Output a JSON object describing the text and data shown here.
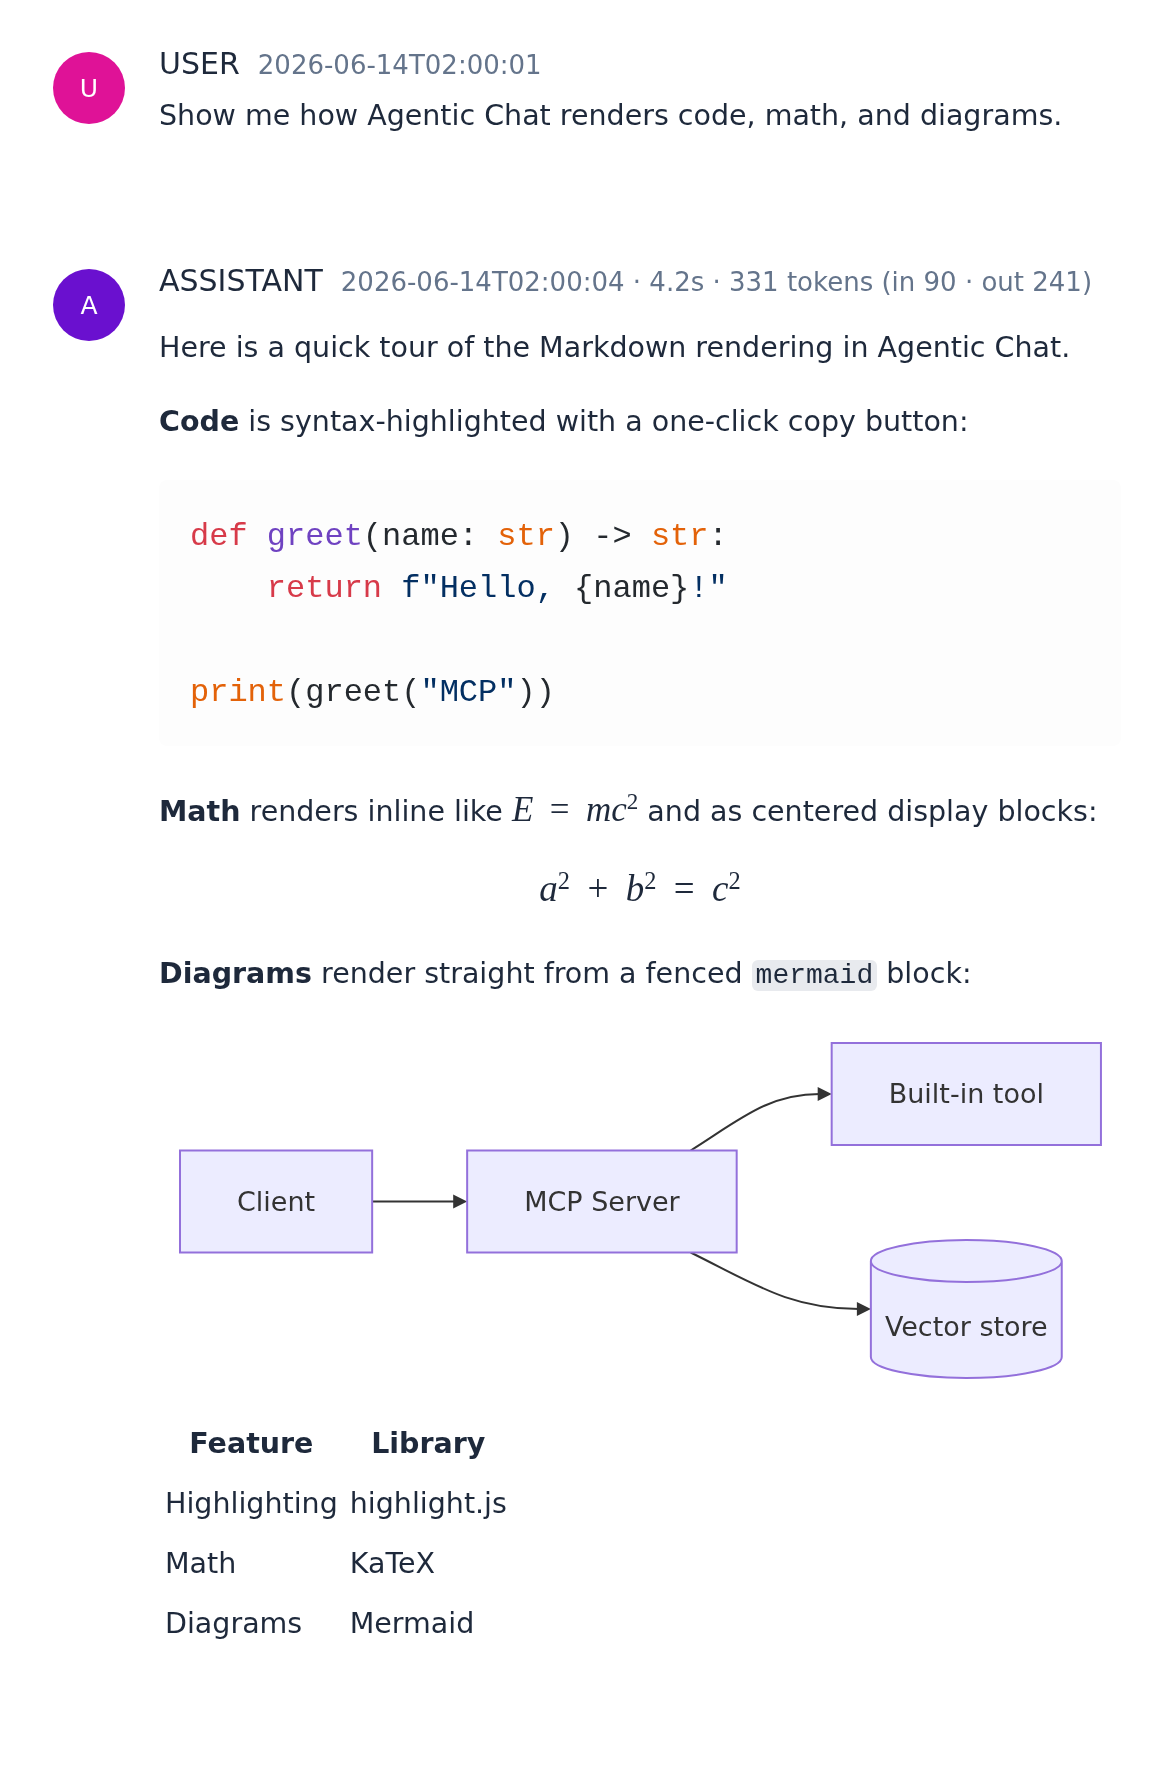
{
  "messages": [
    {
      "kind": "user",
      "role": "USER",
      "avatar": "U",
      "color": "#df1297",
      "meta": "2026-06-14T02:00:01",
      "blocks": [
        {
          "kind": "paragraph",
          "segments": [
            {
              "kind": "text",
              "text": "Show me how Agentic Chat renders code, math, and diagrams."
            }
          ]
        }
      ]
    },
    {
      "kind": "assistant",
      "role": "ASSISTANT",
      "avatar": "A",
      "color": "#6a10cf",
      "meta": "2026-06-14T02:00:04 · 4.2s · 331 tokens (in 90 · out 241)",
      "blocks": [
        {
          "kind": "paragraph",
          "segments": [
            {
              "kind": "text",
              "text": "Here is a quick tour of the Markdown rendering in Agentic Chat."
            }
          ]
        },
        {
          "kind": "paragraph",
          "segments": [
            {
              "kind": "text",
              "text": "**Code** is syntax-highlighted with a one-click copy button:"
            }
          ]
        },
        {
          "kind": "code",
          "lines": [
            {
              "kind": "code",
              "tokens": [
                {
                  "kind": "keyword",
                  "text": "def "
                },
                {
                  "kind": "title",
                  "text": "greet"
                },
                {
                  "kind": "plain",
                  "text": "(name: "
                },
                {
                  "kind": "builtin",
                  "text": "str"
                },
                {
                  "kind": "plain",
                  "text": ") -> "
                },
                {
                  "kind": "builtin",
                  "text": "str"
                },
                {
                  "kind": "plain",
                  "text": ":"
                }
              ]
            },
            {
              "kind": "code",
              "tokens": [
                {
                  "kind": "keyword",
                  "text": "    return "
                },
                {
                  "kind": "string",
                  "text": "f\"Hello, "
                },
                {
                  "kind": "plain",
                  "text": "{name}"
                },
                {
                  "kind": "string",
                  "text": "!\""
                }
              ]
            },
            {
              "kind": "blank"
            },
            {
              "kind": "code",
              "tokens": [
                {
                  "kind": "builtin",
                  "text": "print"
                },
                {
                  "kind": "plain",
                  "text": "(greet("
                },
                {
                  "kind": "string",
                  "text": "\"MCP\""
                },
                {
                  "kind": "plain",
                  "text": "))"
                }
              ]
            }
          ]
        },
        {
          "kind": "paragraph",
          "segments": [
            {
              "kind": "text",
              "text": "**Math** renders inline like "
            },
            {
              "kind": "math",
              "text": "*E* = *mc*$^{2}$"
            },
            {
              "kind": "text",
              "text": " and as centered display blocks:"
            }
          ]
        },
        {
          "kind": "display_math",
          "text": "*a*$^{2}$ + *b*$^{2}$ = *c*$^{2}$"
        },
        {
          "kind": "paragraph",
          "segments": [
            {
              "kind": "text",
              "text": "**Diagrams** render straight from a fenced "
            },
            {
              "kind": "code",
              "text": "mermaid"
            },
            {
              "kind": "text",
              "text": " block:"
            }
          ]
        },
        {
          "kind": "diagram",
          "nodes": [
            {
              "kind": "box",
              "label": "Client",
              "children": [
                {
                  "kind": "box",
                  "label": "MCP Server",
                  "children": [
                    {
                      "kind": "box",
                      "label": "Built-in tool"
                    },
                    {
                      "kind": "cylinder",
                      "label": "Vector store"
                    }
                  ]
                }
              ]
            }
          ]
        },
        {
          "kind": "table",
          "columns": [
            "Feature",
            "Library"
          ],
          "rows": [
            [
              "Highlighting",
              "highlight.js"
            ],
            [
              "Math",
              "KaTeX"
            ],
            [
              "Diagrams",
              "Mermaid"
            ]
          ]
        }
      ]
    }
  ]
}
